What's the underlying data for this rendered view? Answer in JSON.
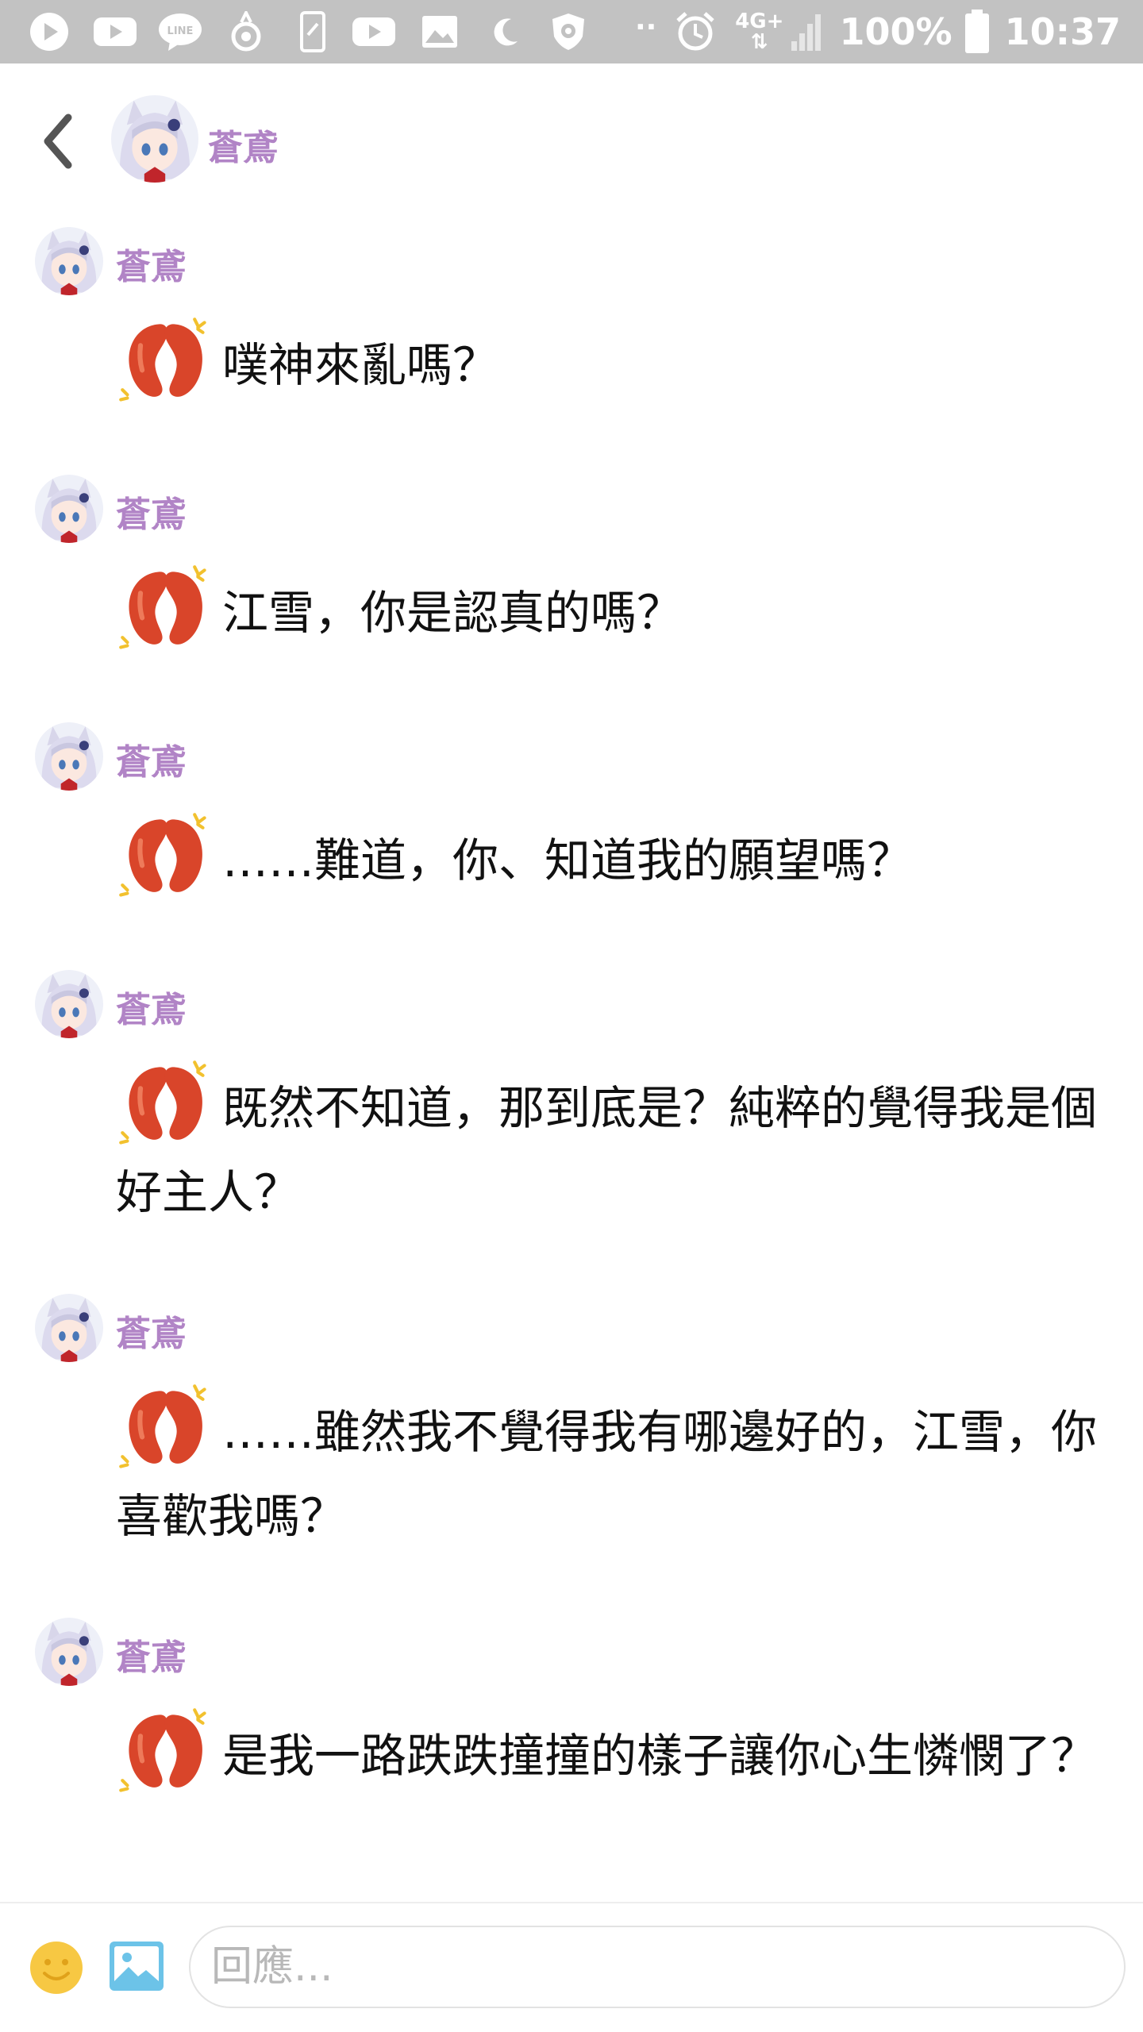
{
  "status_bar": {
    "battery": "100%",
    "time": "10:37",
    "network": "4G+",
    "notification_icons": [
      "play-icon",
      "youtube-icon",
      "line-icon",
      "pokemon-icon",
      "phone-icon",
      "youtube-icon",
      "gallery-icon",
      "moon-icon",
      "shield-icon"
    ],
    "more": "··"
  },
  "header": {
    "title": "蒼鳶",
    "back_icon": "chevron-left-icon"
  },
  "messages": [
    {
      "sender": "蒼鳶",
      "sticker": "kidney-sticker-icon",
      "text": "噗神來亂嗎？"
    },
    {
      "sender": "蒼鳶",
      "sticker": "kidney-sticker-icon",
      "text": "江雪，你是認真的嗎？"
    },
    {
      "sender": "蒼鳶",
      "sticker": "kidney-sticker-icon",
      "text": "……難道，你、知道我的願望嗎？"
    },
    {
      "sender": "蒼鳶",
      "sticker": "kidney-sticker-icon",
      "text": "既然不知道，那到底是？純粹的覺得我是個好主人？"
    },
    {
      "sender": "蒼鳶",
      "sticker": "kidney-sticker-icon",
      "text": "……雖然我不覺得我有哪邊好的，江雪，你喜歡我嗎？"
    },
    {
      "sender": "蒼鳶",
      "sticker": "kidney-sticker-icon",
      "text": "是我一路跌跌撞撞的樣子讓你心生憐憫了？"
    }
  ],
  "composer": {
    "placeholder": "回應...",
    "emoji_icon": "smiley-icon",
    "image_icon": "image-icon"
  },
  "colors": {
    "status_bar": "#c2c2c2",
    "name_accent": "#b184c6",
    "sticker_red": "#d9452a"
  }
}
